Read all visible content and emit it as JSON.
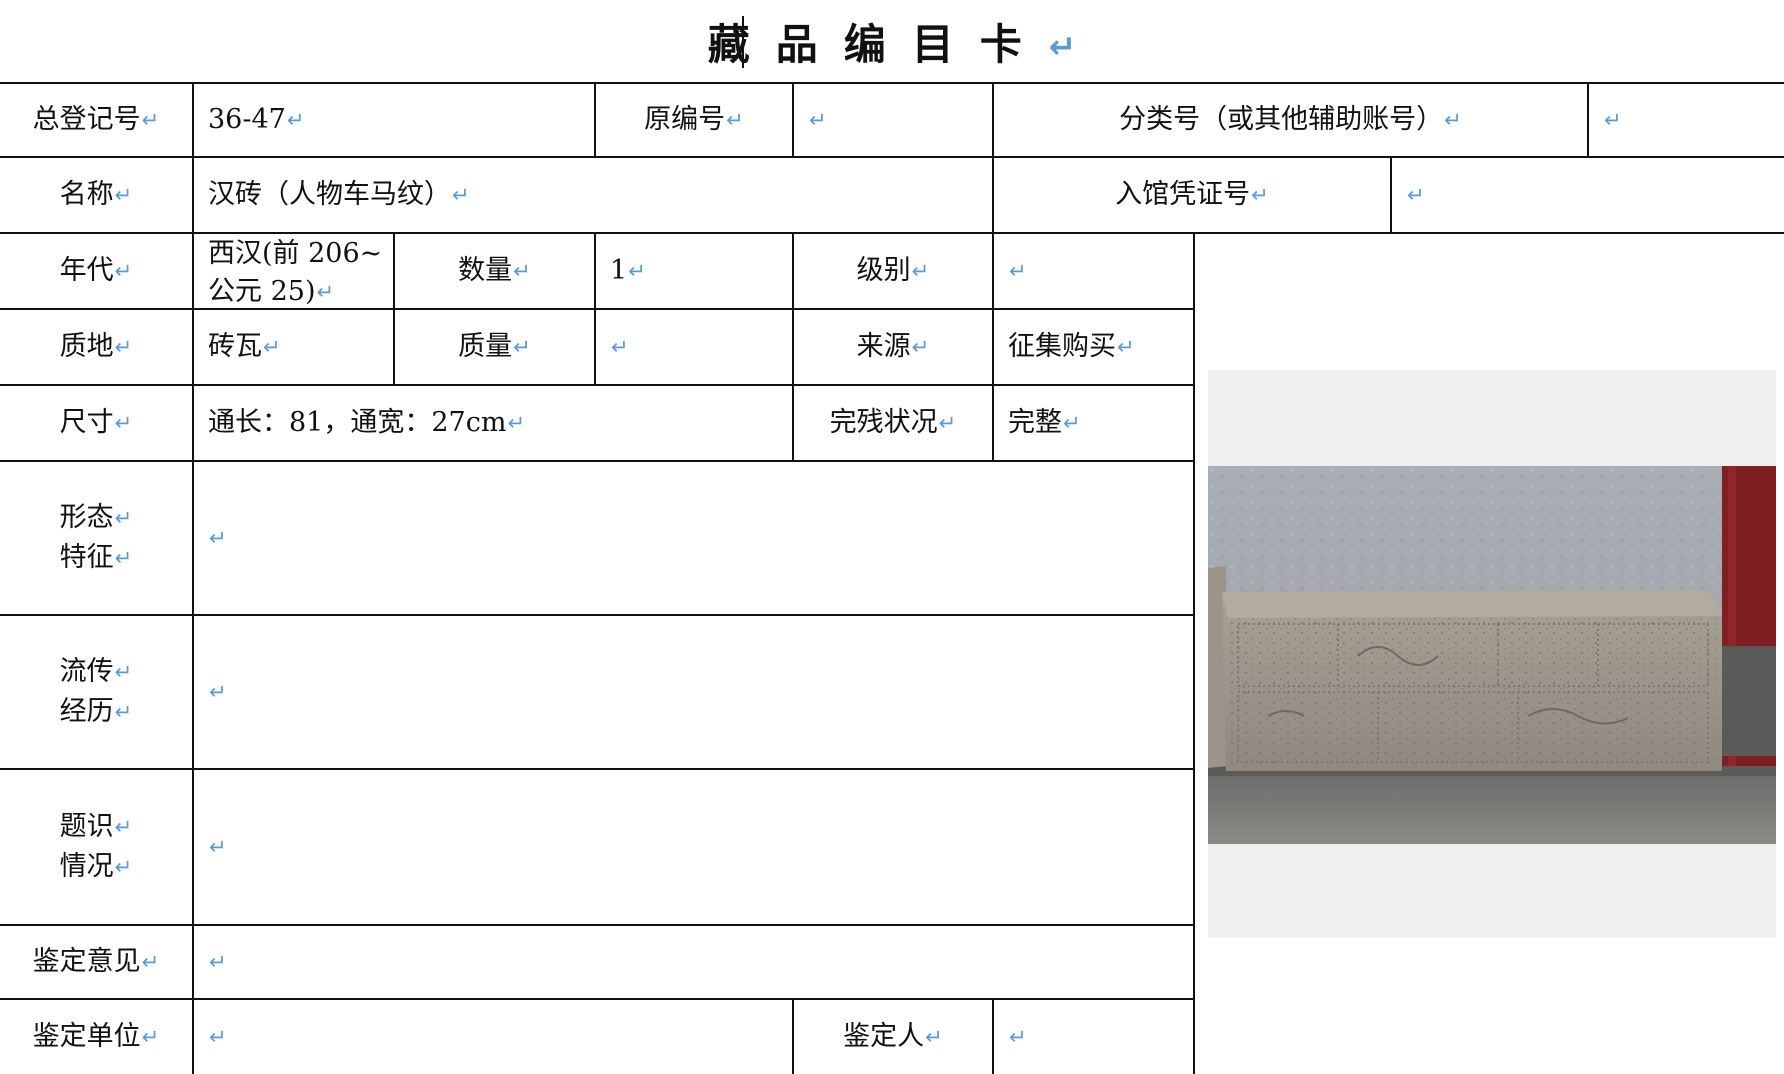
{
  "title": "藏品编目卡",
  "return_mark": "↵",
  "fields": {
    "reg_no_label": "总登记号",
    "reg_no_value": "36-47",
    "orig_no_label": "原编号",
    "orig_no_value": "",
    "class_no_label": "分类号（或其他辅助账号）",
    "class_no_value": "",
    "name_label": "名称",
    "name_value": "汉砖（人物车马纹）",
    "entry_voucher_label": "入馆凭证号",
    "entry_voucher_value": "",
    "era_label": "年代",
    "era_value_line1": "西汉(前 206~",
    "era_value_line2": "公元 25)",
    "quantity_label": "数量",
    "quantity_value": "1",
    "grade_label": "级别",
    "grade_value": "",
    "material_label": "质地",
    "material_value": "砖瓦",
    "weight_label": "质量",
    "weight_value": "",
    "source_label": "来源",
    "source_value": "征集购买",
    "size_label": "尺寸",
    "size_value": "通长：81，通宽：27cm",
    "condition_label": "完残状况",
    "condition_value": "完整",
    "form_label_1": "形态",
    "form_label_2": "特征",
    "form_value": "",
    "history_label_1": "流传",
    "history_label_2": "经历",
    "history_value": "",
    "inscription_label_1": "题识",
    "inscription_label_2": "情况",
    "inscription_value": "",
    "appraisal_opinion_label": "鉴定意见",
    "appraisal_opinion_value": "",
    "appraisal_unit_label": "鉴定单位",
    "appraisal_unit_value": "",
    "appraiser_label": "鉴定人",
    "appraiser_value": ""
  },
  "photo": {
    "subject": "Han dynasty brick with figure and chariot-horse pattern"
  }
}
